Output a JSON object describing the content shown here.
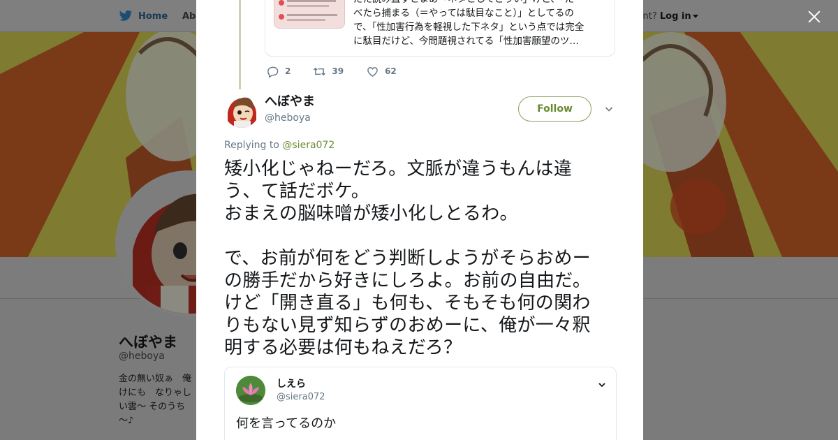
{
  "nav": {
    "home_label": "Home",
    "about_label": "Abo",
    "account_prefix": "ccount?",
    "login_label": "Log in"
  },
  "profile": {
    "name": "へぼやま",
    "handle": "@heboya",
    "bio": "金の無い奴ぁ　俺んとこへ来い　俺も無いけど心配すんな　見ろよ青い空　白い雲～ そのうち何とかなるだろう～♪",
    "bio_lines": [
      "金の無い奴ぁ　俺",
      "けにも　なりゃし",
      "い雲～ そのうち",
      "～♪"
    ]
  },
  "previous_tweet": {
    "card_text_lines": [
      "だた読み直すとまあ「ネタとしてどうい」けど、「た",
      "べたら捕まる（＝やっては駄目なこと）」としてるの",
      "で、「性加害行為を軽視した下ネタ」という点では完全",
      "に駄目だけど、今問題視されてる「性加害願望のツ…"
    ],
    "reply_count": "2",
    "retweet_count": "39",
    "like_count": "62"
  },
  "tweet": {
    "author_name": "へぼやま",
    "author_handle": "@heboya",
    "follow_label": "Follow",
    "replying_prefix": "Replying to",
    "replying_to": "@siera072",
    "lines": [
      "矮小化じゃねーだろ。文脈が違うもんは違",
      "う、て話だボケ。",
      "おまえの脳味噌が矮小化しとるわ。",
      "",
      "で、お前が何をどう判断しようがそらおめー",
      "の勝手だから好きにしろよ。お前の自由だ。",
      "けど「開き直る」も何も、そもそも何の関わ",
      "りもない見ず知らずのおめーに、俺が一々釈",
      "明する必要は何もねえだろ？"
    ]
  },
  "quoted_tweet": {
    "name": "しえら",
    "handle": "@siera072",
    "text": "何を言ってるのか"
  },
  "colors": {
    "accent": "#6e8c36",
    "follow_border": "#8a9f62",
    "muted": "#657786",
    "thread_line": "#c6d5b0"
  },
  "icons": {
    "nav_logo": "bird-icon",
    "close": "close-icon",
    "reply": "reply-icon",
    "retweet": "retweet-icon",
    "like": "heart-icon",
    "more": "chevron-down-icon"
  }
}
